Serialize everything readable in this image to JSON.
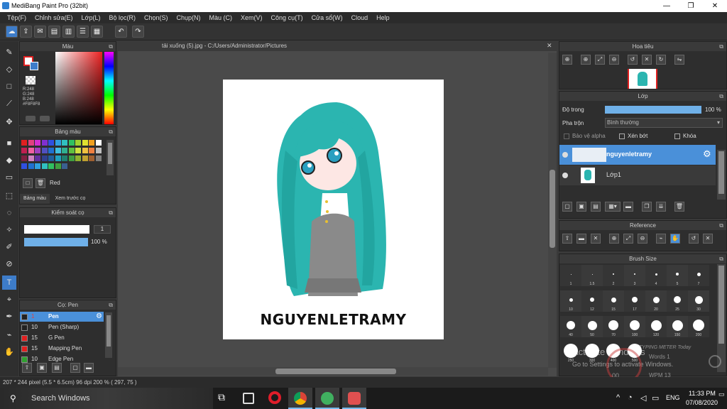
{
  "window": {
    "title": "MediBang Paint Pro (32bit)"
  },
  "menu": [
    "Tệp(F)",
    "Chỉnh sửa(E)",
    "Lớp(L)",
    "Bộ lọc(R)",
    "Chọn(S)",
    "Chụp(N)",
    "Màu (C)",
    "Xem(V)",
    "Công cụ(T)",
    "Cửa sổ(W)",
    "Cloud",
    "Help"
  ],
  "color_panel": {
    "title": "Màu",
    "r": "R:248",
    "g": "G:248",
    "b": "B:248",
    "hex": "#F8F8F8"
  },
  "palette_panel": {
    "title": "Bảng màu",
    "color_name": "Red",
    "tab1": "Bảng màu",
    "tab2": "Xem trước cọ"
  },
  "brush_control": {
    "title": "Kiểm soát cọ",
    "size": "1",
    "opacity": "100 %"
  },
  "brush_panel": {
    "title": "Cọ: Pen",
    "items": [
      {
        "size": "1",
        "name": "Pen",
        "color": "#222222",
        "selected": true
      },
      {
        "size": "10",
        "name": "Pen (Sharp)",
        "color": "#222222",
        "selected": false
      },
      {
        "size": "15",
        "name": "G Pen",
        "color": "#e02020",
        "selected": false
      },
      {
        "size": "15",
        "name": "Mapping Pen",
        "color": "#e02020",
        "selected": false
      },
      {
        "size": "10",
        "name": "Edge Pen",
        "color": "#30a030",
        "selected": false
      }
    ]
  },
  "document": {
    "tab": "tải xuống (5).jpg - C:/Users/Administrator/Pictures",
    "art_text": "NGUYENLETRAMY"
  },
  "navigator": {
    "title": "Hoa tiêu"
  },
  "layer_panel": {
    "title": "Lớp",
    "opacity_label": "Độ trong",
    "opacity_value": "100 %",
    "blend_label": "Pha trộn",
    "blend_value": "Bình thường",
    "alpha_label": "Bảo vệ alpha",
    "clip_label": "Xén bớt",
    "lock_label": "Khóa",
    "layers": [
      {
        "name": "nguyenletramy",
        "selected": true
      },
      {
        "name": "Lớp1",
        "selected": false
      }
    ]
  },
  "reference": {
    "title": "Reference"
  },
  "brush_size": {
    "title": "Brush Size",
    "sizes": [
      "1",
      "1.5",
      "2",
      "3",
      "4",
      "5",
      "7",
      "10",
      "12",
      "15",
      "17",
      "20",
      "25",
      "30",
      "40",
      "50",
      "70",
      "100",
      "120",
      "150",
      "200",
      "250",
      "300",
      "400",
      "500"
    ]
  },
  "status": {
    "text": "207 * 244 pixel   (5.5 * 6.5cm)   96 dpi   200 %   ( 297, 75 )"
  },
  "watermark": {
    "line1": "Activate Windows",
    "line2": "Go to Settings to activate Windows."
  },
  "typing_meter": {
    "title": "TYPING METER Today",
    "words": "Words 1",
    "wpm": "WPM 13",
    "num": "00"
  },
  "taskbar": {
    "search": "Search Windows",
    "lang": "ENG",
    "time": "11:33 PM",
    "date": "07/08/2020"
  },
  "colors": {
    "accent": "#3d7cc9",
    "layer_sel": "#4a90d9",
    "hair": "#2bb5b0"
  }
}
